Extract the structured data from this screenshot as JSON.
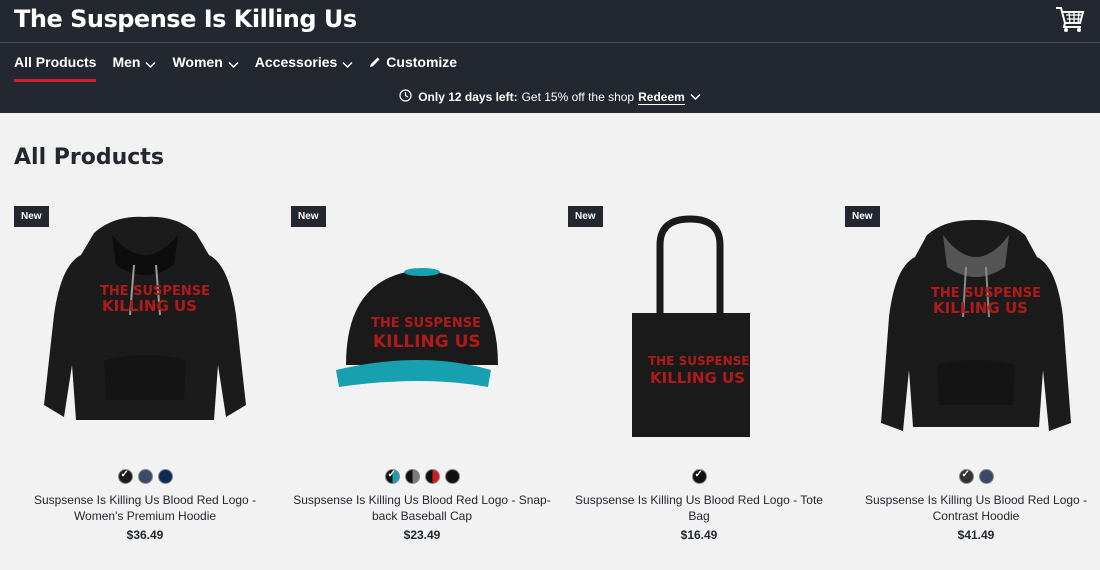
{
  "header": {
    "shop_title": "The Suspense Is Killing Us",
    "cart_icon": "cart-icon"
  },
  "nav": {
    "items": [
      {
        "label": "All Products",
        "active": true
      },
      {
        "label": "Men",
        "dropdown": true
      },
      {
        "label": "Women",
        "dropdown": true
      },
      {
        "label": "Accessories",
        "dropdown": true
      },
      {
        "label": "Customize",
        "icon": "pencil-icon"
      }
    ]
  },
  "promo": {
    "highlight": "Only 12 days left:",
    "text": "Get 15% off the shop",
    "link": "Redeem"
  },
  "page": {
    "heading": "All Products"
  },
  "products": [
    {
      "badge": "New",
      "name": "Suspsense Is Killing Us Blood Red Logo - Women's Premium Hoodie",
      "price": "$36.49",
      "swatches": [
        "#1a1a1a",
        "#3a4a66",
        "#0f2a55"
      ]
    },
    {
      "badge": "New",
      "name": "Suspsense Is Killing Us Blood Red Logo - Snap-back Baseball Cap",
      "price": "$23.49",
      "swatches": [
        "#17a0b0",
        "#7a7a7a",
        "#cc1e1e",
        "#111111"
      ]
    },
    {
      "badge": "New",
      "name": "Suspsense Is Killing Us Blood Red Logo - Tote Bag",
      "price": "$16.49",
      "swatches": [
        "#111111"
      ]
    },
    {
      "badge": "New",
      "name": "Suspsense Is Killing Us Blood Red Logo - Contrast Hoodie",
      "price": "$41.49",
      "swatches": [
        "#333333",
        "#3a4a66"
      ]
    }
  ],
  "colors": {
    "header_bg": "#23272f",
    "accent": "#d0202f",
    "page_bg": "#f2f2f2",
    "logo_red": "#b01a1a"
  }
}
